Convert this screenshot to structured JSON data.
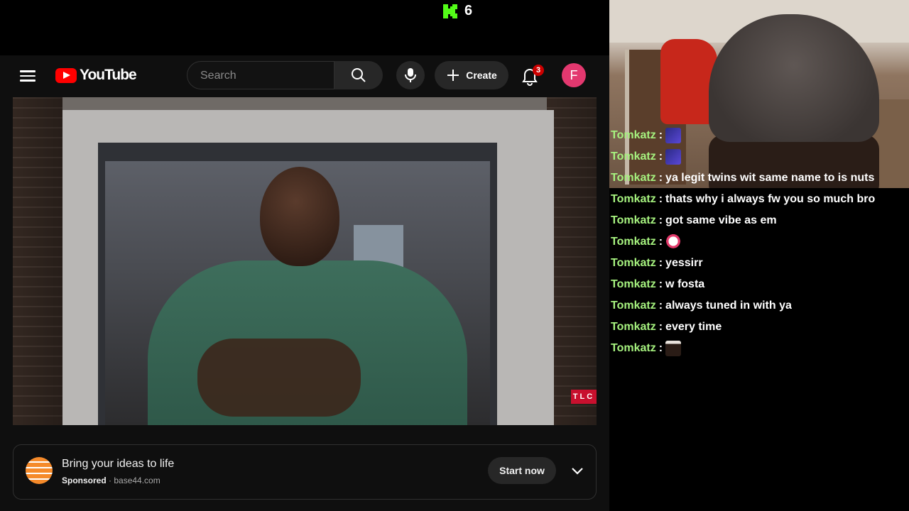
{
  "stream": {
    "viewer_count": "6",
    "platform_icon": "kick-logo-icon"
  },
  "youtube": {
    "logo_text": "YouTube",
    "search": {
      "placeholder": "Search"
    },
    "create_label": "Create",
    "notification_count": "3",
    "avatar_initial": "F",
    "video": {
      "channel_badge": "TLC"
    },
    "ad": {
      "title": "Bring your ideas to life",
      "sponsored_label": "Sponsored",
      "separator": " · ",
      "domain": "base44.com",
      "cta_label": "Start now"
    }
  },
  "chat": {
    "separator": ":",
    "messages": [
      {
        "user": "Tomkatz",
        "text": "",
        "emote": "blue-emote"
      },
      {
        "user": "Tomkatz",
        "text": "",
        "emote": "blue-emote"
      },
      {
        "user": "Tomkatz",
        "text": "ya legit twins wit same name to is nuts",
        "emote": ""
      },
      {
        "user": "Tomkatz",
        "text": "thats why i always fw you so much bro",
        "emote": ""
      },
      {
        "user": "Tomkatz",
        "text": "got same vibe as em",
        "emote": ""
      },
      {
        "user": "Tomkatz",
        "text": "",
        "emote": "ghost-emote"
      },
      {
        "user": "Tomkatz",
        "text": "yessirr",
        "emote": ""
      },
      {
        "user": "Tomkatz",
        "text": "w fosta",
        "emote": ""
      },
      {
        "user": "Tomkatz",
        "text": "always tuned in with ya",
        "emote": ""
      },
      {
        "user": "Tomkatz",
        "text": "every time",
        "emote": ""
      },
      {
        "user": "Tomkatz",
        "text": "",
        "emote": "person-emote"
      }
    ]
  },
  "colors": {
    "chat_username": "#a6f27f",
    "youtube_red": "#ff0000",
    "avatar_bg": "#e3386f",
    "badge_red": "#cc0000",
    "kick_green": "#53fc18"
  }
}
